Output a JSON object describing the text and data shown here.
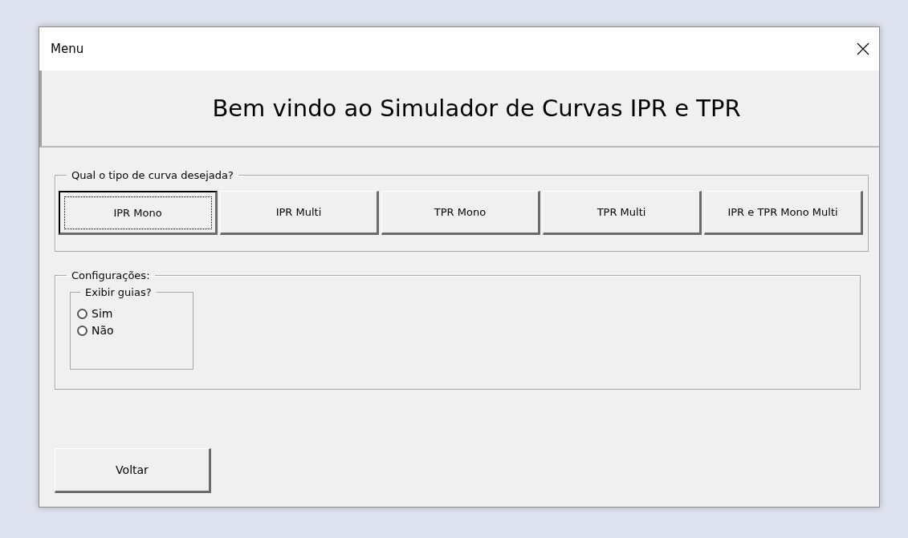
{
  "window": {
    "title": "Menu"
  },
  "heading": "Bem vindo ao Simulador de Curvas IPR e TPR",
  "curve_group": {
    "legend": "Qual o tipo de curva desejada?",
    "buttons": [
      {
        "label": "IPR Mono",
        "focused": true
      },
      {
        "label": "IPR Multi",
        "focused": false
      },
      {
        "label": "TPR Mono",
        "focused": false
      },
      {
        "label": "TPR Multi",
        "focused": false
      },
      {
        "label": "IPR e TPR Mono Multi",
        "focused": false
      }
    ]
  },
  "settings_group": {
    "legend": "Configurações:",
    "guides_group": {
      "legend": "Exibir guias?",
      "options": [
        {
          "label": "Sim",
          "selected": false
        },
        {
          "label": "Não",
          "selected": false
        }
      ]
    }
  },
  "back_button": "Voltar"
}
